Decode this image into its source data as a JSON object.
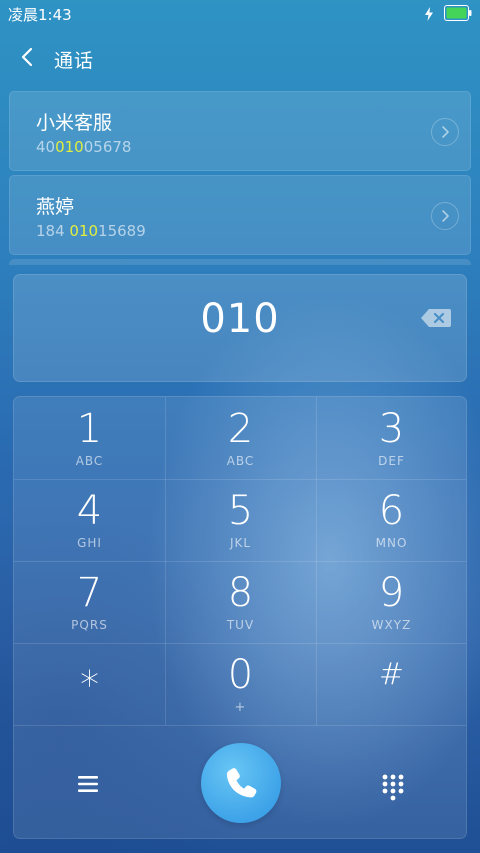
{
  "status": {
    "time": "凌晨1:43"
  },
  "header": {
    "title": "通话"
  },
  "contacts": [
    {
      "name": "小米客服",
      "number_pre": "40",
      "number_hl": "010",
      "number_post": "05678"
    },
    {
      "name": "燕婷",
      "number_pre": "184 ",
      "number_hl": "010",
      "number_post": "15689"
    }
  ],
  "dial": {
    "digits": "010"
  },
  "keys": [
    {
      "num": "1",
      "letters": "ABC"
    },
    {
      "num": "2",
      "letters": "ABC"
    },
    {
      "num": "3",
      "letters": "DEF"
    },
    {
      "num": "4",
      "letters": "GHI"
    },
    {
      "num": "5",
      "letters": "JKL"
    },
    {
      "num": "6",
      "letters": "MNO"
    },
    {
      "num": "7",
      "letters": "PQRS"
    },
    {
      "num": "8",
      "letters": "TUV"
    },
    {
      "num": "9",
      "letters": "WXYZ"
    },
    {
      "num": "∗",
      "letters": ""
    },
    {
      "num": "0",
      "letters": "+"
    },
    {
      "num": "#",
      "letters": ""
    }
  ],
  "icons": {
    "back": "chevron-left-icon",
    "backspace": "backspace-icon",
    "menu": "menu-icon",
    "call": "phone-icon",
    "keypad": "keypad-grid-icon"
  },
  "colors": {
    "highlight": "#e2ee3d",
    "call_button": "#3ea3e8",
    "battery": "#45d45a"
  }
}
